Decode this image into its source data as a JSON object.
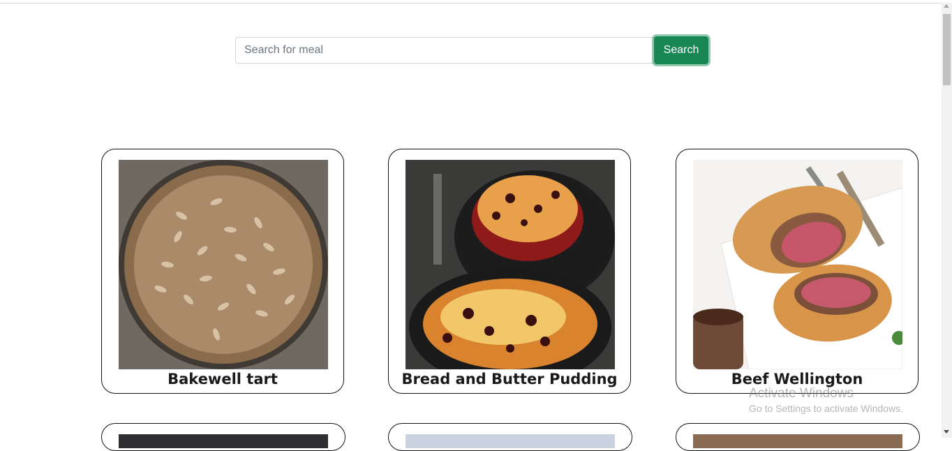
{
  "search": {
    "placeholder": "Search for meal",
    "value": "",
    "button_label": "Search"
  },
  "meals": [
    {
      "title": "Bakewell tart",
      "image": "bakewell-tart-photo"
    },
    {
      "title": "Bread and Butter Pudding",
      "image": "bread-and-butter-pudding-photo"
    },
    {
      "title": "Beef Wellington",
      "image": "beef-wellington-photo"
    }
  ],
  "watermark": {
    "title": "Activate Windows",
    "subtitle": "Go to Settings to activate Windows."
  },
  "colors": {
    "accent": "#198754",
    "card_border": "#111111",
    "background": "#ffffff"
  }
}
